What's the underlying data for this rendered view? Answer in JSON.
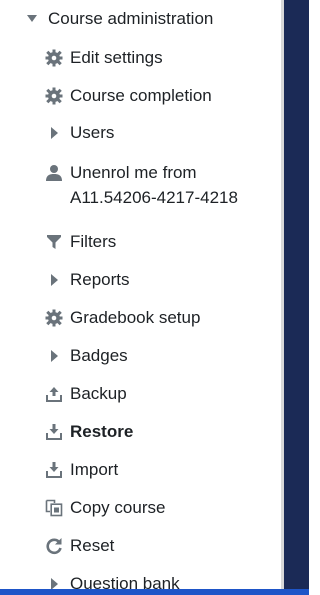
{
  "nav": {
    "header": "Course administration",
    "items": [
      {
        "label": "Edit settings"
      },
      {
        "label": "Course completion"
      },
      {
        "label": "Users"
      },
      {
        "label_line1": "Unenrol me from",
        "label_line2": "A11.54206-4217-4218"
      },
      {
        "label": "Filters"
      },
      {
        "label": "Reports"
      },
      {
        "label": "Gradebook setup"
      },
      {
        "label": "Badges"
      },
      {
        "label": "Backup"
      },
      {
        "label": "Restore"
      },
      {
        "label": "Import"
      },
      {
        "label": "Copy course"
      },
      {
        "label": "Reset"
      },
      {
        "label": "Question bank"
      }
    ]
  },
  "colors": {
    "icon": "#6a737b",
    "text": "#1d2125",
    "right_panel": "#1b2a56",
    "bottom_bar": "#1e55c8"
  },
  "icons": [
    "caret-down-icon",
    "gear-icon",
    "gear-icon",
    "caret-right-icon",
    "user-icon",
    "filter-icon",
    "caret-right-icon",
    "gear-icon",
    "caret-right-icon",
    "upload-icon",
    "download-icon",
    "download-icon",
    "copy-icon",
    "reset-icon",
    "caret-right-icon"
  ]
}
